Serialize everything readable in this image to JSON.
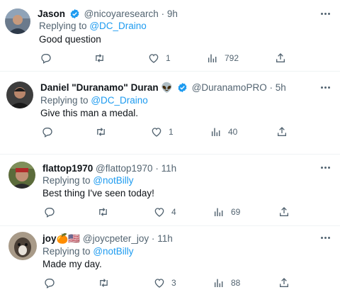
{
  "tweets": [
    {
      "name": "Jason",
      "handle": "@nicoyaresearch",
      "dot": "·",
      "time": "9h",
      "replying_prefix": "Replying to",
      "replying_to": "@DC_Draino",
      "text": "Good question",
      "likes": "1",
      "views": "792",
      "verified": true,
      "name_suffix": ""
    },
    {
      "name": "Daniel \"Duranamo\" Duran",
      "name_suffix": "👽",
      "handle": "@DuranamoPRO",
      "dot": "·",
      "time": "5h",
      "replying_prefix": "Replying to",
      "replying_to": "@DC_Draino",
      "text": "Give this man a medal.",
      "likes": "1",
      "views": "40",
      "verified": true
    },
    {
      "name": "flattop1970",
      "name_suffix": "",
      "handle": "@flattop1970",
      "dot": "·",
      "time": "11h",
      "replying_prefix": "Replying to",
      "replying_to": "@notBilly",
      "text": "Best thing I've seen today!",
      "likes": "4",
      "views": "69",
      "verified": false
    },
    {
      "name": "joy",
      "name_suffix": "🍊🇺🇸",
      "handle": "@joycpeter_joy",
      "dot": "·",
      "time": "11h",
      "replying_prefix": "Replying to",
      "replying_to": "@notBilly",
      "text": "Made my day.",
      "likes": "3",
      "views": "88",
      "verified": false
    }
  ],
  "icons": {
    "reply": "reply-icon",
    "retweet": "retweet-icon",
    "like": "heart-icon",
    "views": "views-icon",
    "share": "share-icon",
    "more": "more-icon",
    "verified": "verified-badge-icon"
  },
  "colors": {
    "link": "#1d9bf0",
    "secondary_text": "#536471",
    "verified": "#1d9bf0",
    "divider": "#eff3f4"
  }
}
